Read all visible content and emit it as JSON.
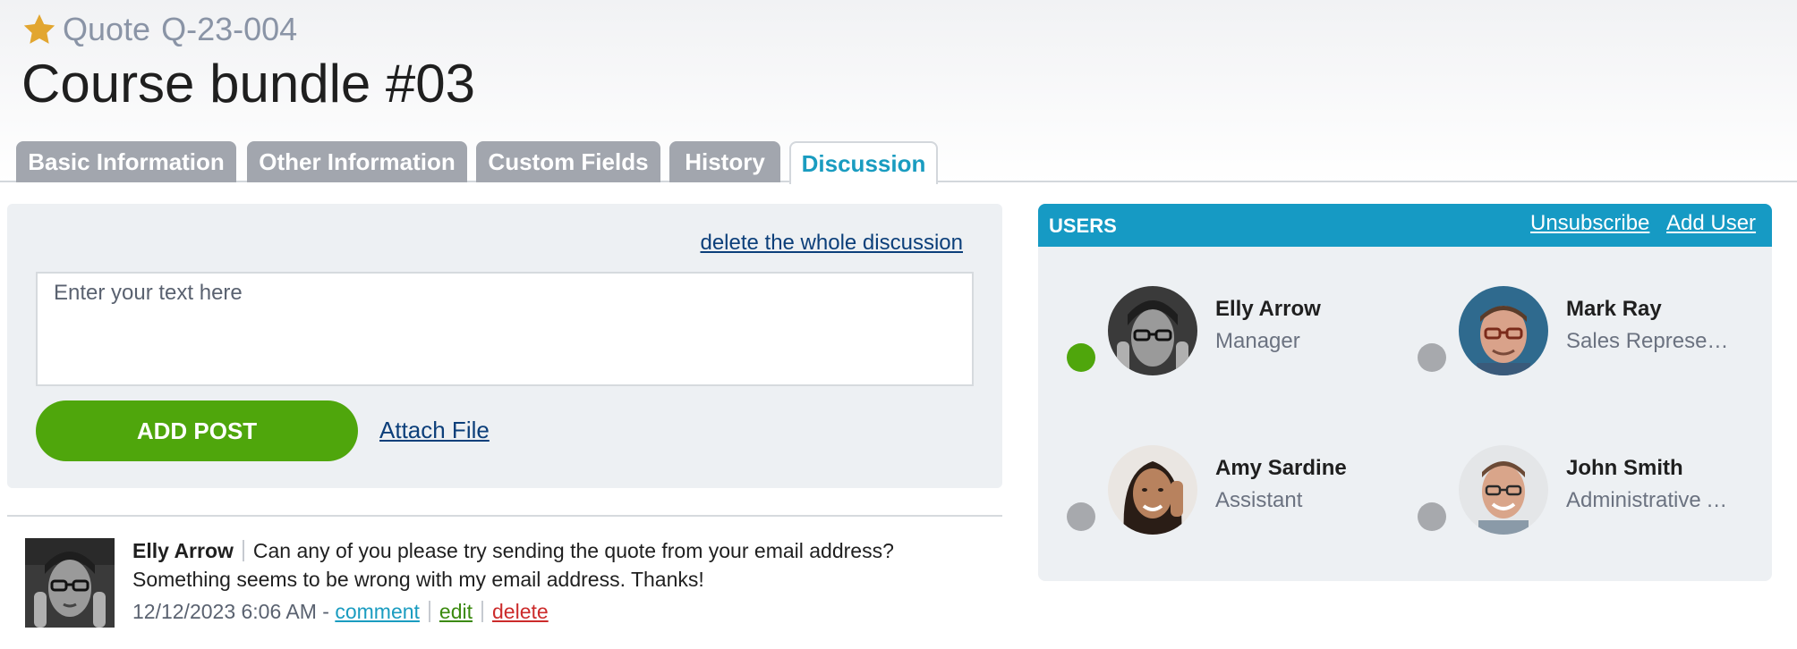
{
  "record": {
    "type": "Quote",
    "id": "Q-23-004",
    "title": "Course bundle #03"
  },
  "tabs": [
    {
      "label": "Basic Information",
      "active": false
    },
    {
      "label": "Other Information",
      "active": false
    },
    {
      "label": "Custom Fields",
      "active": false
    },
    {
      "label": "History",
      "active": false
    },
    {
      "label": "Discussion",
      "active": true
    }
  ],
  "discussion": {
    "delete_all_label": "delete the whole discussion",
    "input_placeholder": "Enter your text here",
    "add_post_label": "ADD POST",
    "attach_file_label": "Attach File",
    "posts": [
      {
        "author": "Elly Arrow",
        "text": "Can any of you please try sending the quote from your email address? Something seems to be wrong with my email address. Thanks!",
        "timestamp": "12/12/2023 6:06 AM - ",
        "comment_label": "comment",
        "edit_label": "edit",
        "delete_label": "delete"
      }
    ]
  },
  "users": {
    "title": "USERS",
    "unsubscribe_label": "Unsubscribe",
    "add_user_label": "Add User",
    "list": [
      {
        "name": "Elly Arrow",
        "role": "Manager",
        "online": true
      },
      {
        "name": "Mark Ray",
        "role": "Sales Representative",
        "online": false
      },
      {
        "name": "Amy Sardine",
        "role": "Assistant",
        "online": false
      },
      {
        "name": "John Smith",
        "role": "Administrative Assistant",
        "online": false
      }
    ]
  },
  "colors": {
    "accent": "#169ac4",
    "tab_inactive": "#a2a6ae",
    "add_post": "#4fa60c",
    "online": "#4fa60c",
    "offline": "#a7a9ad",
    "star": "#e2a630"
  }
}
